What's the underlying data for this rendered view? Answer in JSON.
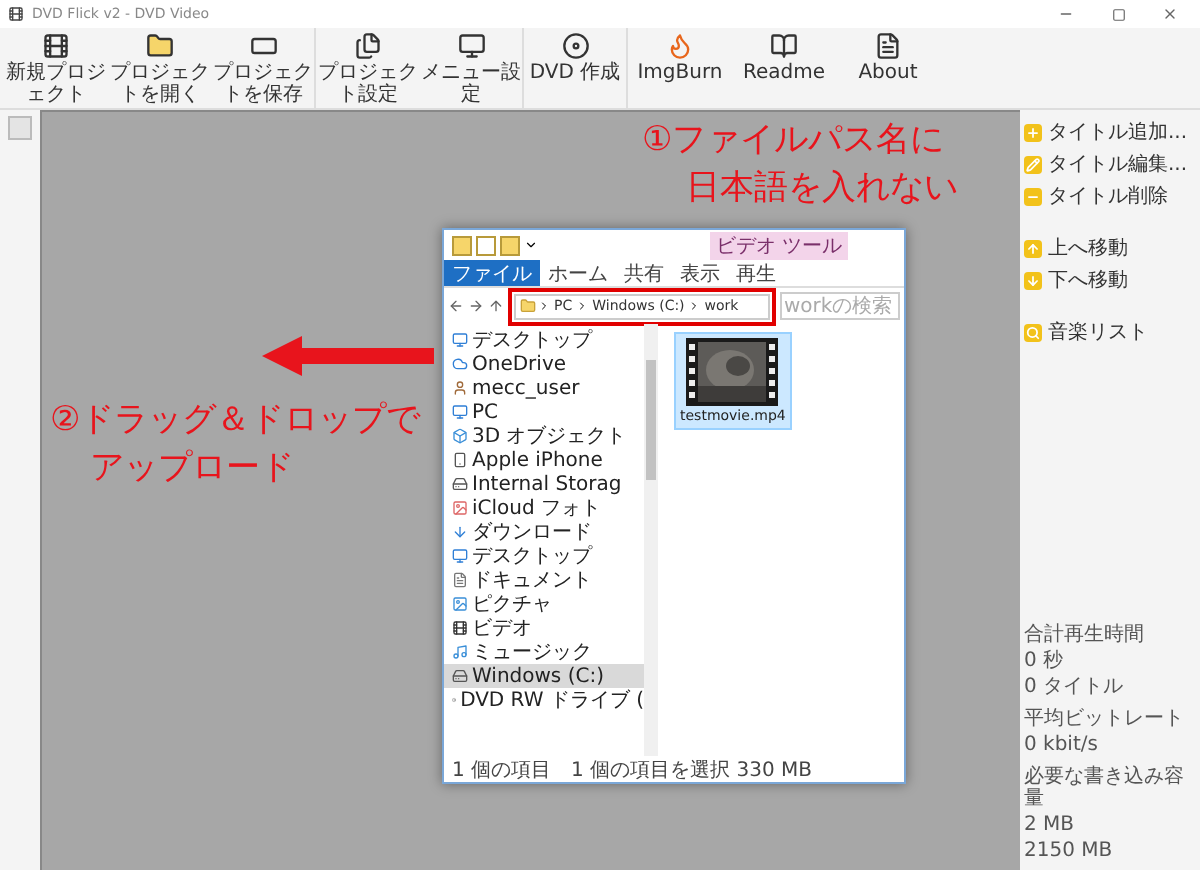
{
  "window": {
    "title": "DVD Flick v2 - DVD Video"
  },
  "toolbar": {
    "buttons": [
      {
        "label": "新規プロジェクト"
      },
      {
        "label": "プロジェクトを開く"
      },
      {
        "label": "プロジェクトを保存"
      },
      {
        "label": "プロジェクト設定"
      },
      {
        "label": "メニュー設定"
      },
      {
        "label": "DVD 作成"
      },
      {
        "label": "ImgBurn"
      },
      {
        "label": "Readme"
      },
      {
        "label": "About"
      }
    ]
  },
  "side_panel": {
    "groups": [
      {
        "actions": [
          {
            "label": "タイトル追加..."
          },
          {
            "label": "タイトル編集..."
          },
          {
            "label": "タイトル削除"
          }
        ]
      },
      {
        "actions": [
          {
            "label": "上へ移動"
          },
          {
            "label": "下へ移動"
          }
        ]
      },
      {
        "actions": [
          {
            "label": "音楽リスト"
          }
        ]
      }
    ],
    "stats": [
      {
        "lines": [
          "合計再生時間",
          "0 秒",
          "0 タイトル"
        ]
      },
      {
        "lines": [
          "平均ビットレート",
          "0 kbit/s"
        ]
      },
      {
        "lines": [
          "必要な書き込み容量",
          "2 MB",
          "2150 MB"
        ]
      }
    ]
  },
  "explorer": {
    "context_tab": "ビデオ ツール",
    "tabs": [
      {
        "label": "ファイル",
        "selected": true
      },
      {
        "label": "ホーム",
        "selected": false
      },
      {
        "label": "共有",
        "selected": false
      },
      {
        "label": "表示",
        "selected": false
      },
      {
        "label": "再生",
        "selected": false
      }
    ],
    "path": [
      "PC",
      "Windows (C:)",
      "work"
    ],
    "search": {
      "placeholder": "workの検索"
    },
    "nav_items": [
      {
        "label": "デスクトップ",
        "selected": false
      },
      {
        "label": "OneDrive",
        "selected": false
      },
      {
        "label": "mecc_user",
        "selected": false
      },
      {
        "label": "PC",
        "selected": false
      },
      {
        "label": "3D オブジェクト",
        "selected": false
      },
      {
        "label": "Apple iPhone",
        "selected": false
      },
      {
        "label": "Internal Storag",
        "selected": false
      },
      {
        "label": "iCloud フォト",
        "selected": false
      },
      {
        "label": "ダウンロード",
        "selected": false
      },
      {
        "label": "デスクトップ",
        "selected": false
      },
      {
        "label": "ドキュメント",
        "selected": false
      },
      {
        "label": "ピクチャ",
        "selected": false
      },
      {
        "label": "ビデオ",
        "selected": false
      },
      {
        "label": "ミュージック",
        "selected": false
      },
      {
        "label": "Windows (C:)",
        "selected": true
      },
      {
        "label": "DVD RW ドライブ (",
        "selected": false
      }
    ],
    "files": [
      {
        "name": "testmovie.mp4",
        "selected": true
      }
    ],
    "status": [
      "1 個の項目",
      "1 個の項目を選択 330 MB"
    ]
  },
  "annotations": [
    {
      "lines": [
        "①ファイルパス名に",
        "日本語を入れない"
      ]
    },
    {
      "lines": [
        "②ドラッグ＆ドロップで",
        "アップロード"
      ]
    }
  ]
}
